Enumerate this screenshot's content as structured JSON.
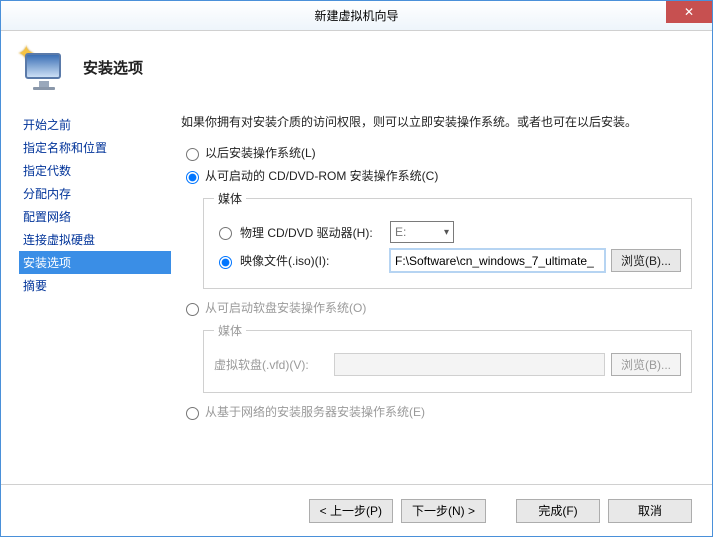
{
  "window": {
    "title": "新建虚拟机向导"
  },
  "header": {
    "title": "安装选项"
  },
  "sidebar": {
    "items": [
      {
        "label": "开始之前"
      },
      {
        "label": "指定名称和位置"
      },
      {
        "label": "指定代数"
      },
      {
        "label": "分配内存"
      },
      {
        "label": "配置网络"
      },
      {
        "label": "连接虚拟硬盘"
      },
      {
        "label": "安装选项"
      },
      {
        "label": "摘要"
      }
    ],
    "selected_index": 6
  },
  "content": {
    "intro": "如果你拥有对安装介质的访问权限，则可以立即安装操作系统。或者也可在以后安装。",
    "opt_later": "以后安装操作系统(L)",
    "opt_cd": "从可启动的 CD/DVD-ROM 安装操作系统(C)",
    "opt_floppy": "从可启动软盘安装操作系统(O)",
    "opt_network": "从基于网络的安装服务器安装操作系统(E)",
    "selected_option": "cd",
    "cd_group": {
      "legend": "媒体",
      "physical_label": "物理 CD/DVD 驱动器(H):",
      "drive_value": "E:",
      "iso_label": "映像文件(.iso)(I):",
      "iso_value": "F:\\Software\\cn_windows_7_ultimate_",
      "browse": "浏览(B)...",
      "selected": "iso"
    },
    "floppy_group": {
      "legend": "媒体",
      "vfd_label": "虚拟软盘(.vfd)(V):",
      "vfd_value": "",
      "browse": "浏览(B)..."
    }
  },
  "footer": {
    "prev": "< 上一步(P)",
    "next": "下一步(N) >",
    "finish": "完成(F)",
    "cancel": "取消"
  }
}
